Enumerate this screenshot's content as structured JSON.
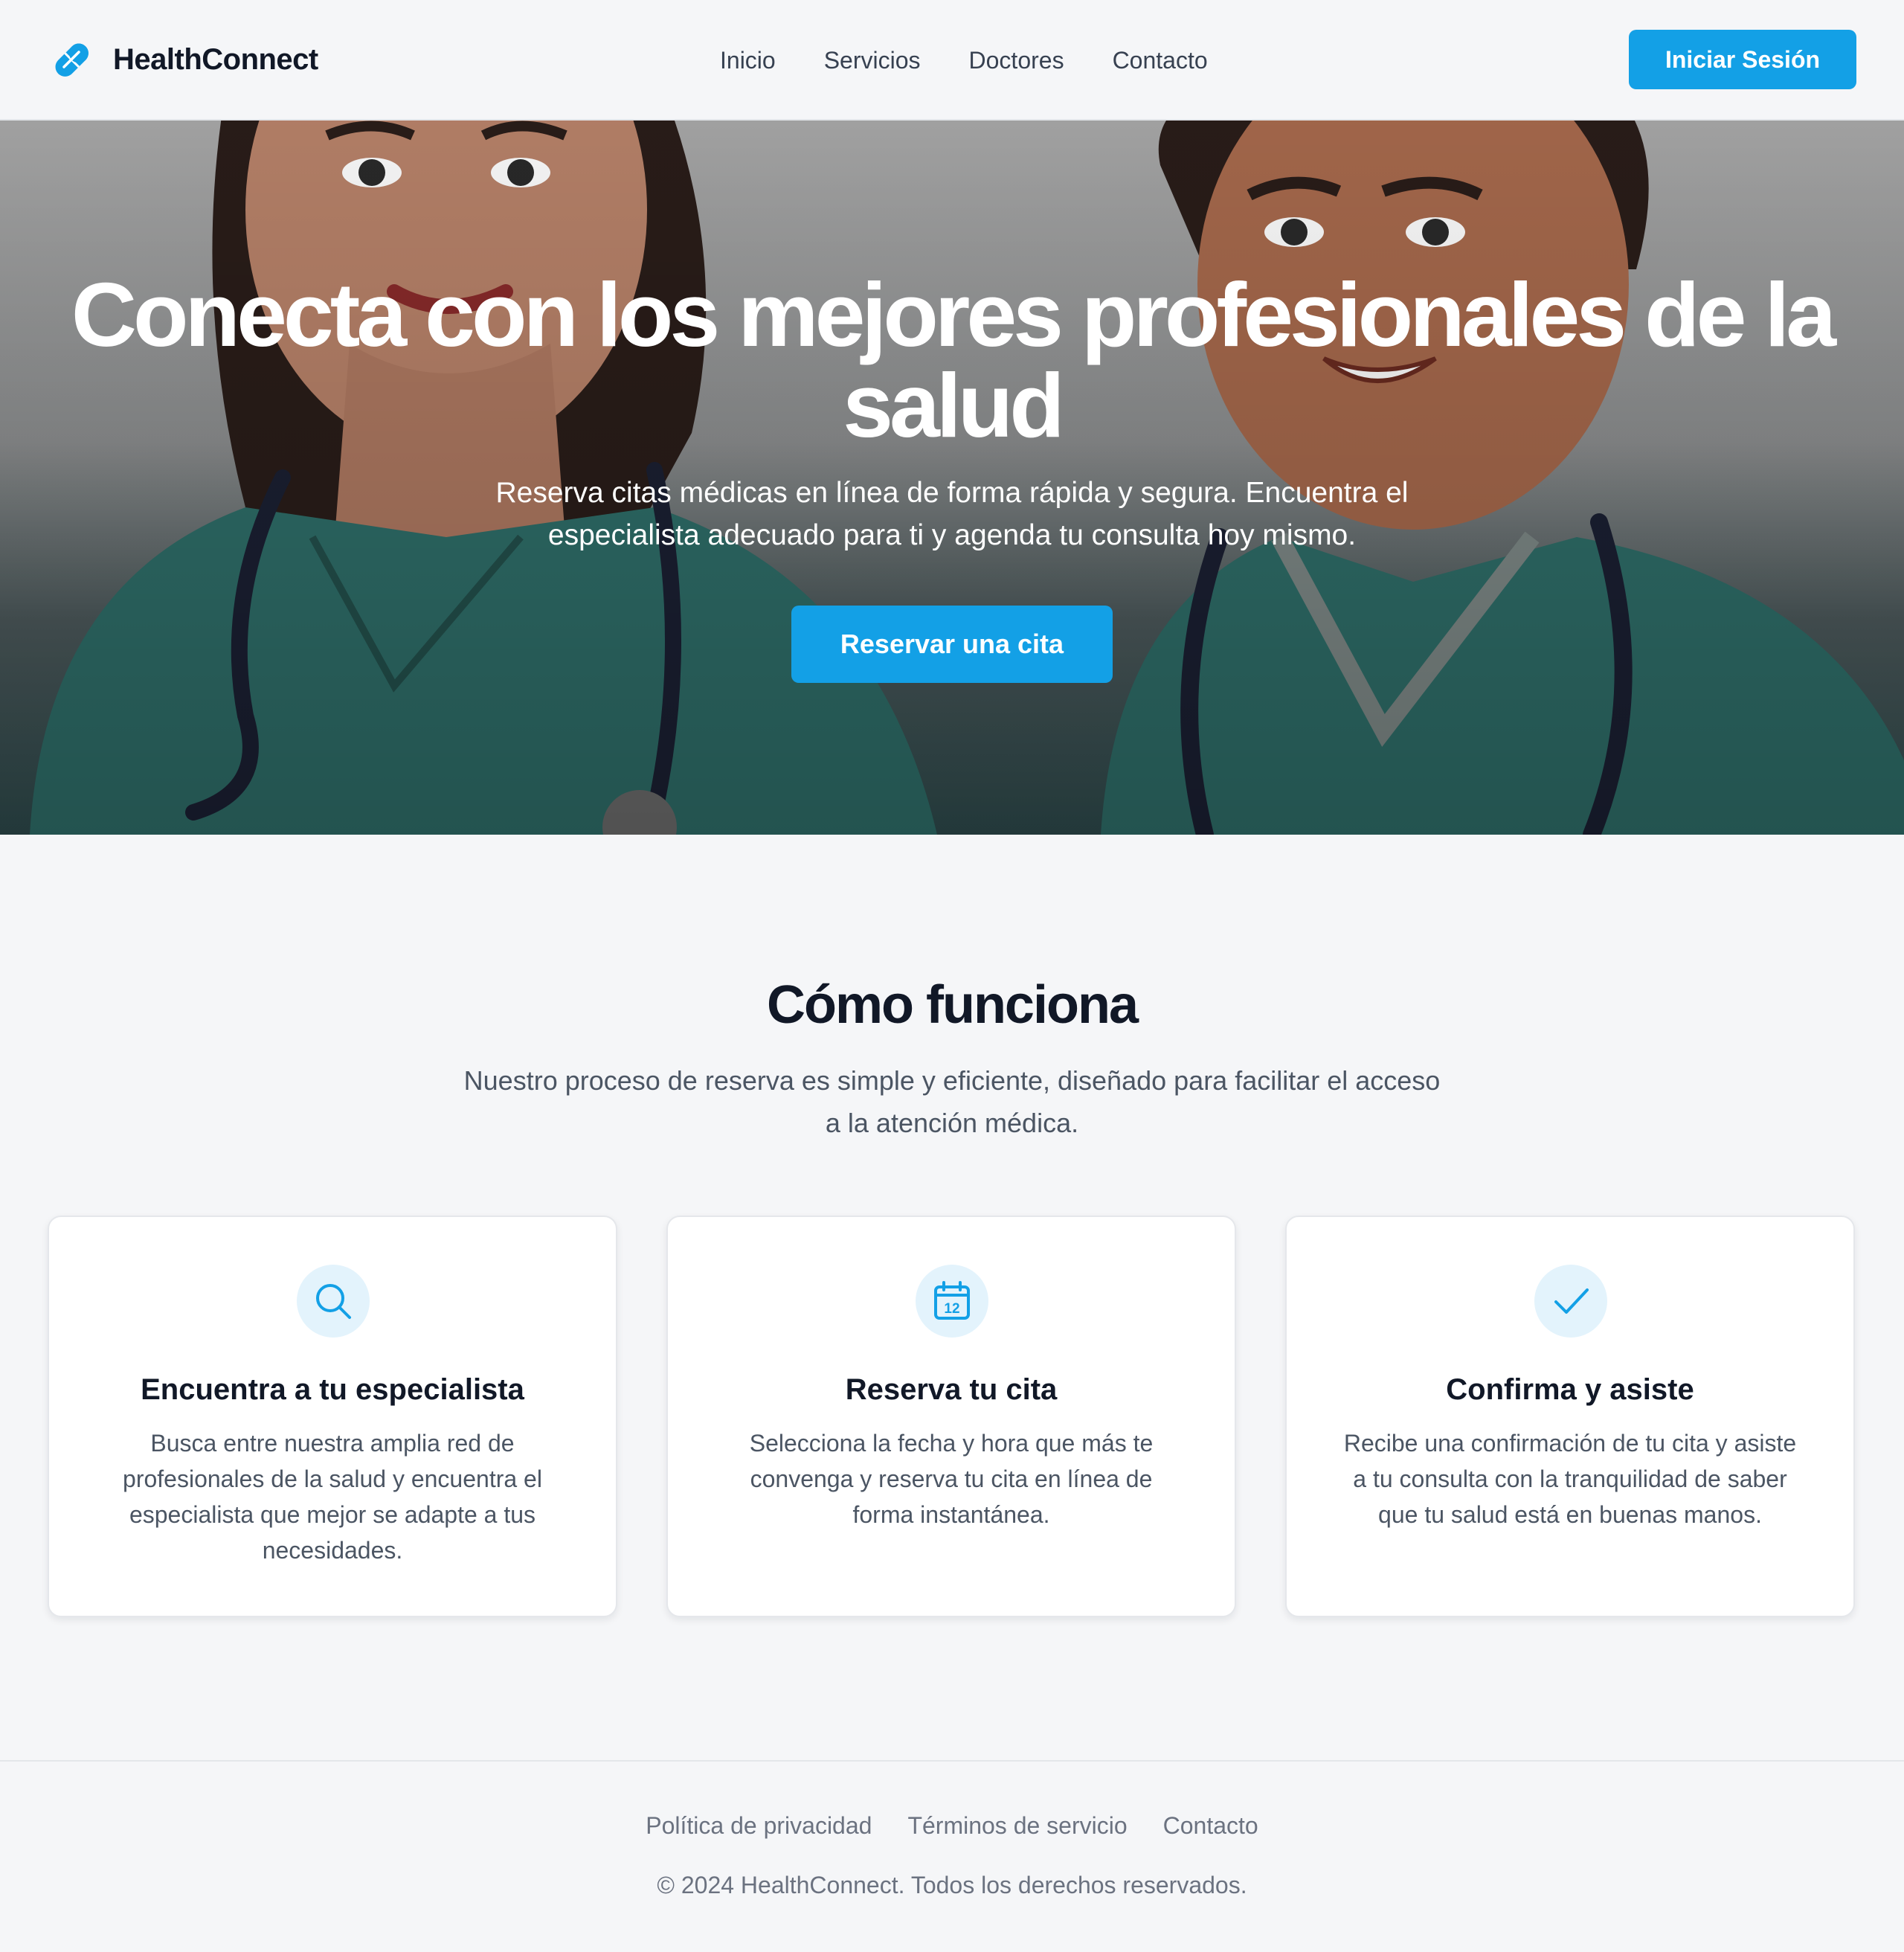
{
  "header": {
    "brand_name": "HealthConnect",
    "nav": [
      "Inicio",
      "Servicios",
      "Doctores",
      "Contacto"
    ],
    "login_label": "Iniciar Sesión"
  },
  "hero": {
    "title": "Conecta con los mejores profesionales de la salud",
    "subtitle": "Reserva citas médicas en línea de forma rápida y segura. Encuentra el especialista adecuado para ti y agenda tu consulta hoy mismo.",
    "cta_label": "Reservar una cita",
    "image_subject": "illustration of two smiling doctors in teal scrubs with stethoscopes"
  },
  "how_it_works": {
    "title": "Cómo funciona",
    "subtitle": "Nuestro proceso de reserva es simple y eficiente, diseñado para facilitar el acceso a la atención médica.",
    "cards": [
      {
        "icon": "search-icon",
        "title": "Encuentra a tu especialista",
        "text": "Busca entre nuestra amplia red de profesionales de la salud y encuentra el especialista que mejor se adapte a tus necesidades."
      },
      {
        "icon": "calendar-icon",
        "icon_text": "12",
        "title": "Reserva tu cita",
        "text": "Selecciona la fecha y hora que más te convenga y reserva tu cita en línea de forma instantánea."
      },
      {
        "icon": "check-icon",
        "title": "Confirma y asiste",
        "text": "Recibe una confirmación de tu cita y asiste a tu consulta con la tranquilidad de saber que tu salud está en buenas manos."
      }
    ]
  },
  "footer": {
    "links": [
      "Política de privacidad",
      "Términos de servicio",
      "Contacto"
    ],
    "copyright": "© 2024 HealthConnect. Todos los derechos reservados."
  },
  "colors": {
    "accent": "#13a0e6",
    "background": "#f5f6f8",
    "heading": "#111827",
    "body_text": "#4b5563",
    "icon_bg": "#e3f3fc"
  }
}
